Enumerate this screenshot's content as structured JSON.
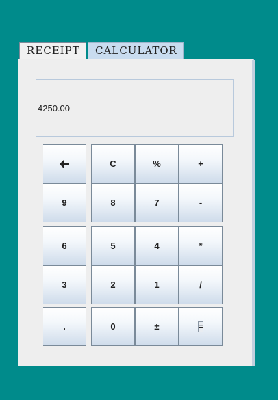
{
  "tabs": [
    {
      "label": "RECEIPT"
    },
    {
      "label": "CALCULATOR"
    }
  ],
  "display": {
    "value": "4250.00"
  },
  "keys": {
    "back": "backspace-arrow",
    "clear": "C",
    "percent": "%",
    "plus": "+",
    "nine": "9",
    "eight": "8",
    "seven": "7",
    "minus": "-",
    "six": "6",
    "five": "5",
    "four": "4",
    "multiply": "*",
    "three": "3",
    "two": "2",
    "one": "1",
    "divide": "/",
    "dot": ".",
    "zero": "0",
    "plus_minus": "±",
    "equals": "="
  }
}
